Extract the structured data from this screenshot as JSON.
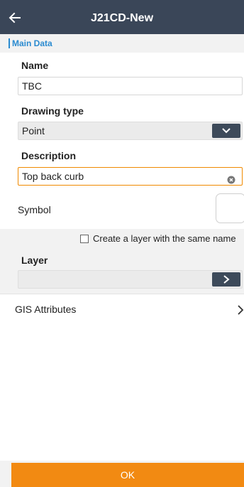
{
  "app": {
    "title": "J21CD-New"
  },
  "status": {
    "partial_text": "...) ... ... ... ... ..."
  },
  "section": {
    "main_data": "Main Data"
  },
  "form": {
    "name": {
      "label": "Name",
      "value": "TBC"
    },
    "drawing_type": {
      "label": "Drawing type",
      "value": "Point"
    },
    "description": {
      "label": "Description",
      "value": "Top back curb"
    },
    "symbol": {
      "label": "Symbol"
    },
    "same_layer_checkbox": {
      "label": "Create a layer with the same name",
      "checked": false
    },
    "layer": {
      "label": "Layer",
      "value": ""
    }
  },
  "gis": {
    "label": "GIS Attributes"
  },
  "actions": {
    "ok_label": "OK"
  },
  "icons": {
    "back": "arrow-left-icon",
    "dropdown": "chevron-down-icon",
    "clear": "clear-circle-icon",
    "next": "chevron-right-icon"
  },
  "colors": {
    "appbar": "#3a4658",
    "accent_blue": "#2b8bd0",
    "accent_orange": "#f28a12",
    "button_dark": "#3d4a5a"
  }
}
